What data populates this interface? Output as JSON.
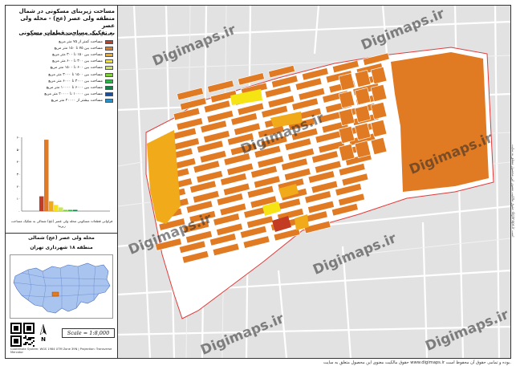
{
  "panel": {
    "title_line1": "مساحت زیربنای مسکونی در شمال",
    "title_line2": "منطقه ولی عصر (عج) - محله ولی عصر",
    "title_line3": "به تفکیک مساحت قطعات مسکونی",
    "legend_title": "راهنمای مساحت زیربنای قطعات مسکونی شمالی",
    "legend": [
      {
        "label": "مساحت کمتر از ۷۵ متر مربع",
        "color": "#c23b22"
      },
      {
        "label": "مساحت بین ۷۵ تا ۱۵۰ متر مربع",
        "color": "#e07b24"
      },
      {
        "label": "مساحت بین ۱۵۰ تا ۳۰۰ متر مربع",
        "color": "#f0aa1a"
      },
      {
        "label": "مساحت بین ۳۰۰ تا ۶۰۰ متر مربع",
        "color": "#f5e313"
      },
      {
        "label": "مساحت بین ۶۰۰ تا ۱۵۰۰ متر مربع",
        "color": "#c9e65b"
      },
      {
        "label": "مساحت بین ۱۵۰۰ تا ۳۰۰۰ متر مربع",
        "color": "#7fd13b"
      },
      {
        "label": "مساحت بین ۳۰۰۰ تا ۶۰۰۰ متر مربع",
        "color": "#2db34a"
      },
      {
        "label": "مساحت بین ۶۰۰۰ تا ۱۰۰۰۰ متر مربع",
        "color": "#15804a"
      },
      {
        "label": "مساحت بین ۱۰۰۰۰ تا ۲۰۰۰۰ متر مربع",
        "color": "#1f4e99"
      },
      {
        "label": "مساحت بیشتر از ۲۰۰۰۰ متر مربع",
        "color": "#2a8fc4"
      }
    ],
    "histogram_caption": "فراوانی قطعات مسکونی محله ولی عصر (عج) شمالی به تفکیک مساحت زیربنا",
    "district_line1": "محله ولی عصر (عج) شمالی",
    "district_line2": "منطقه ۱۸ شهرداری تهران",
    "scale_text": "Scale = 1:8,000",
    "north_letter": "N",
    "credit": "Coordinate System: WGS 1984 UTM Zone 39N | Projection: Transverse Mercator"
  },
  "chart_data": {
    "type": "bar",
    "categories": [
      "<75",
      "75-150",
      "150-300",
      "300-600",
      "600-1500",
      "1500-3000",
      "3000-6000",
      "6000-10000",
      "10000-20000",
      ">20000"
    ],
    "values": [
      12,
      58,
      8,
      5,
      3,
      1,
      1,
      1,
      0,
      0
    ],
    "colors": [
      "#c23b22",
      "#e07b24",
      "#f0aa1a",
      "#f5e313",
      "#c9e65b",
      "#7fd13b",
      "#2db34a",
      "#15804a",
      "#1f4e99",
      "#2a8fc4"
    ],
    "y_ticks": [
      "۰",
      "۱۰",
      "۲۰",
      "۳۰",
      "۴۰",
      "۵۰",
      "۶۰"
    ],
    "ylim": [
      0,
      60
    ],
    "grid": false
  },
  "map": {
    "watermark": "Digimaps.ir",
    "colors": {
      "background": "#e2e2e2",
      "boundary": "#e23b3b",
      "street": "#ffffff",
      "block_main": "#e07b24",
      "block_large": "#f0aa1a",
      "block_yellow": "#f5e313",
      "block_small": "#c23b22",
      "inset_city": "#a9c4ef",
      "inset_area": "#e07b24"
    }
  },
  "footer": {
    "text": "حقوق مالکیت معنوی این محصول متعلق به سایت www.digimaps.ir بوده و تمامی حقوق آن محفوظ است."
  },
  "sidenote": "حقوق مالکیت معنوی این محصول متعلق به سایت digimaps.ir است"
}
